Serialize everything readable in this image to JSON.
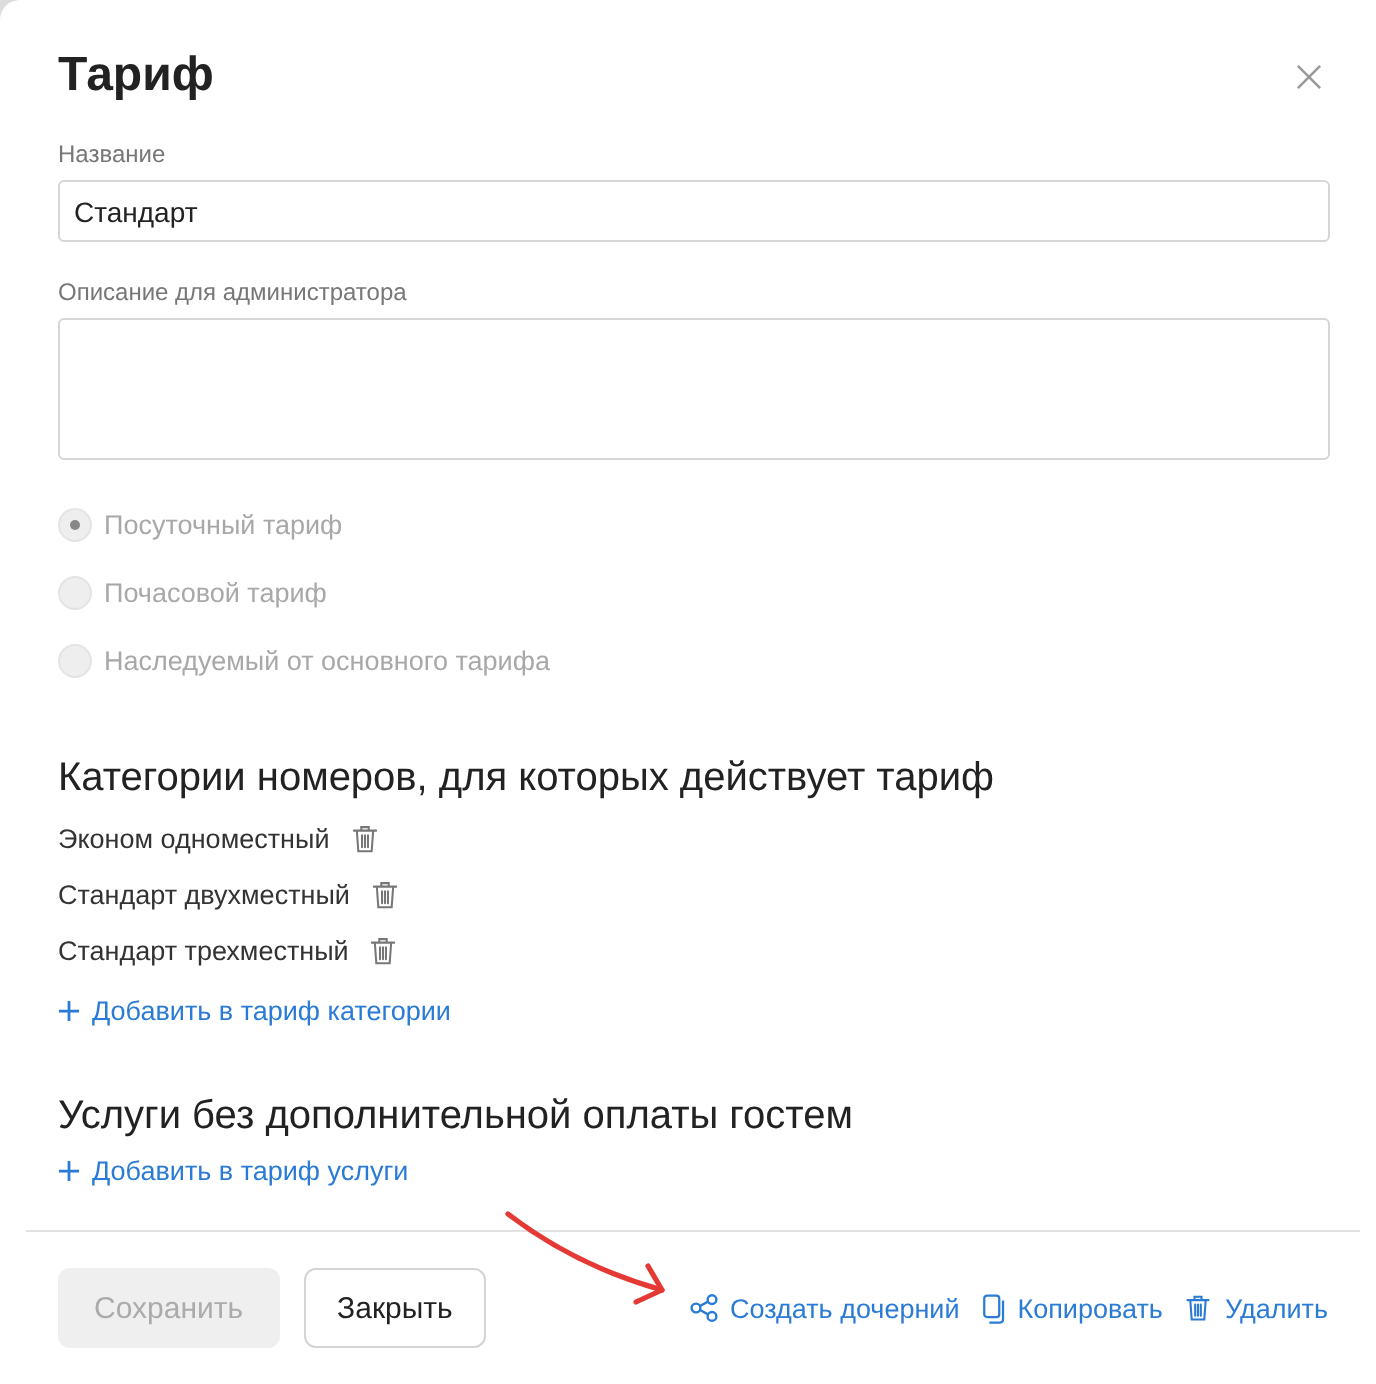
{
  "dialog": {
    "title": "Тариф"
  },
  "fields": [
    {
      "kind": "input",
      "label": "Название",
      "value": "Стандарт"
    },
    {
      "kind": "textarea",
      "label": "Описание для администратора"
    }
  ],
  "tariff_types": [
    {
      "label": "Посуточный тариф",
      "selected": true,
      "disabled": true
    },
    {
      "label": "Почасовой тариф",
      "selected": false,
      "disabled": true
    },
    {
      "label": "Наследуемый от основного тарифа",
      "selected": false,
      "disabled": true
    }
  ],
  "sections": [
    {
      "title": "Категории номеров, для которых действует тариф",
      "items": [
        "Эконом одноместный",
        "Стандарт двухместный",
        "Стандарт трехместный"
      ],
      "add_link": "Добавить в тариф категории"
    },
    {
      "title": "Услуги без дополнительной оплаты гостем",
      "add_link": "Добавить в тариф услуги"
    }
  ],
  "footer": {
    "buttons": [
      {
        "kind": "primary",
        "label": "Сохранить",
        "disabled": true
      },
      {
        "kind": "secondary",
        "label": "Закрыть",
        "disabled": false
      }
    ],
    "actions": [
      {
        "kind": "share",
        "label": "Создать дочерний"
      },
      {
        "kind": "copy",
        "label": "Копировать"
      },
      {
        "kind": "delete",
        "label": "Удалить"
      }
    ]
  }
}
